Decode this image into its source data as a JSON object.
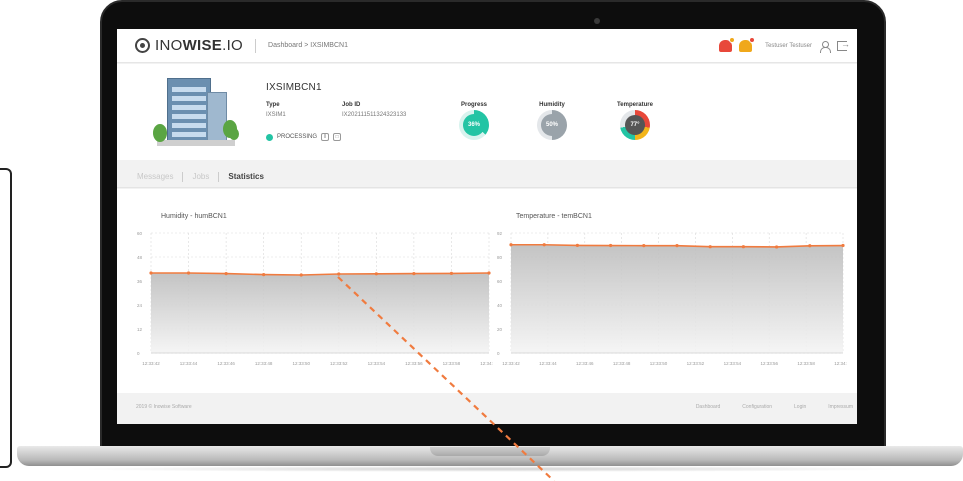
{
  "header": {
    "logo_prefix": "INO",
    "logo_bold": "WISE",
    "logo_suffix": ".IO",
    "breadcrumb": "Dashboard > IXSIMBCN1",
    "user_name": "Testuser Testuser"
  },
  "machine": {
    "title": "IXSIMBCN1",
    "type_label": "Type",
    "type_value": "IXSIM1",
    "job_label": "Job ID",
    "job_value": "IX202111511324323133",
    "status": "PROCESSING",
    "progress_label": "Progress",
    "progress_value": "36%",
    "humidity_label": "Humidity",
    "humidity_value": "50%",
    "temperature_label": "Temperature",
    "temperature_value": "77°"
  },
  "tabs": {
    "messages": "Messages",
    "jobs": "Jobs",
    "statistics": "Statistics"
  },
  "colors": {
    "accent": "#f07b3f",
    "progress": "#23c4a4",
    "humidity": "#9aa3aa",
    "status_processing": "#23c4a4"
  },
  "chart_data": [
    {
      "type": "area",
      "title": "Humidity - humBCN1",
      "x": [
        "12:33:42",
        "12:33:44",
        "12:33:46",
        "12:33:48",
        "12:33:50",
        "12:33:52",
        "12:33:54",
        "12:33:56",
        "12:33:58",
        "12:34:00"
      ],
      "values": [
        40,
        40,
        39.7,
        39.2,
        39,
        39.5,
        39.6,
        39.7,
        39.8,
        40
      ],
      "yticks": [
        "60",
        "48",
        "36",
        "24",
        "12",
        "0"
      ],
      "ylim": [
        0,
        60
      ]
    },
    {
      "type": "area",
      "title": "Temperature - temBCN1",
      "x": [
        "12:33:42",
        "12:33:44",
        "12:33:46",
        "12:33:48",
        "12:33:50",
        "12:33:52",
        "12:33:54",
        "12:33:56",
        "12:33:58",
        "12:34:00"
      ],
      "values": [
        83,
        83,
        82.5,
        82.4,
        82.3,
        82.3,
        81.5,
        81.5,
        81.3,
        82.2,
        82.4
      ],
      "yticks": [
        "92",
        "80",
        "60",
        "40",
        "20",
        "0"
      ],
      "ylim": [
        0,
        92
      ]
    }
  ],
  "footer": {
    "copyright": "2019 © Inowise Software",
    "links": [
      "Dashboard",
      "Configuration",
      "Login",
      "Impressum"
    ]
  }
}
